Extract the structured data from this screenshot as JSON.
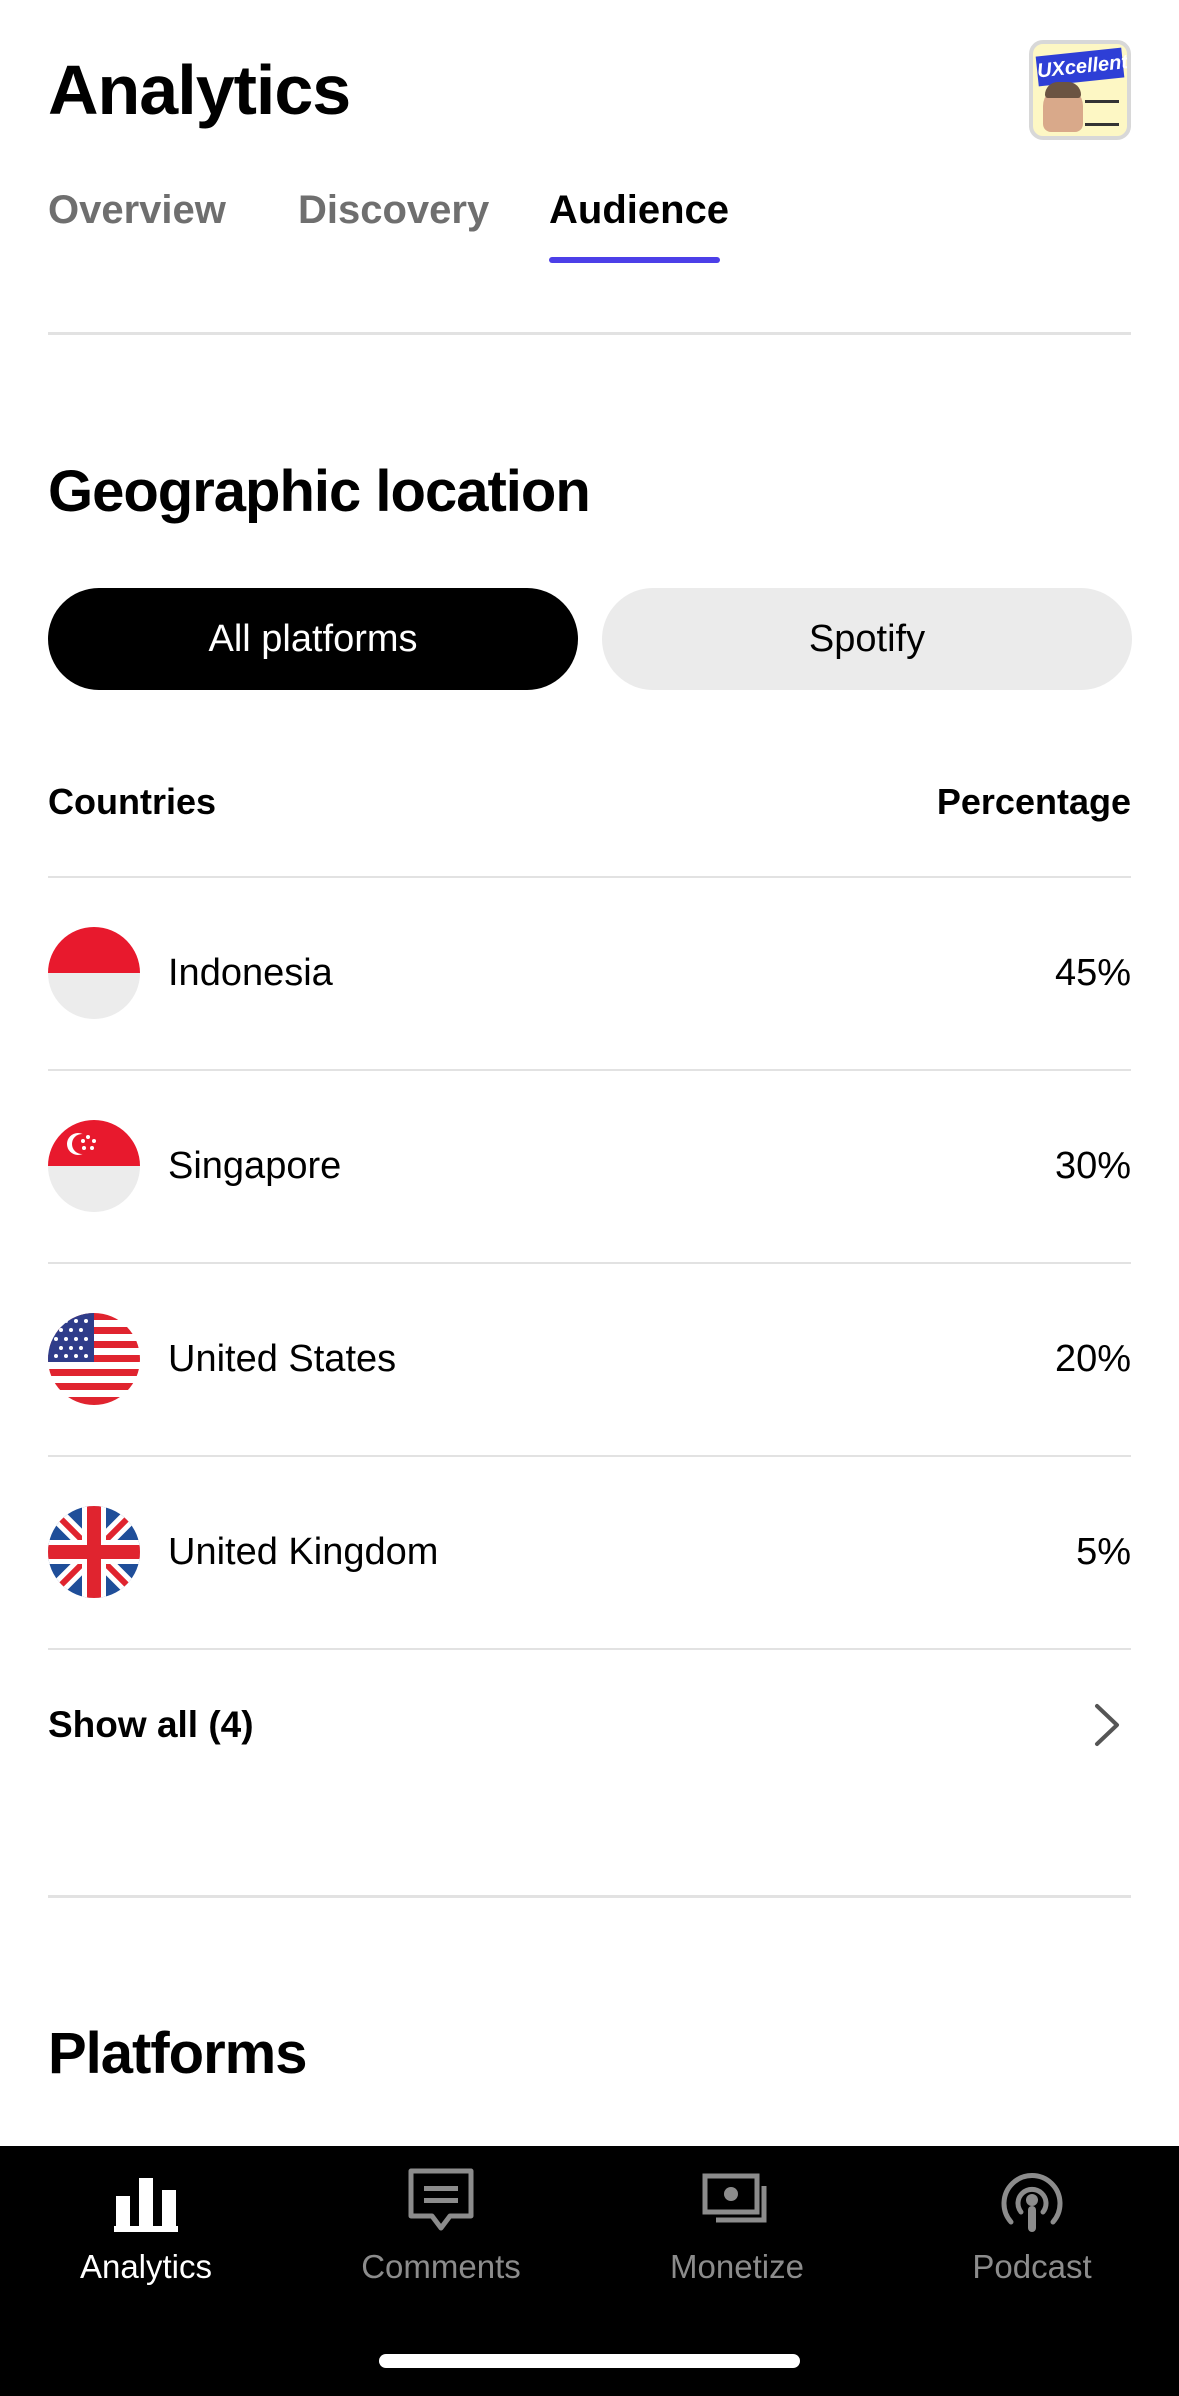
{
  "header": {
    "title": "Analytics",
    "avatar_logo_text": "UXcellent"
  },
  "tabs": [
    {
      "label": "Overview",
      "active": false
    },
    {
      "label": "Discovery",
      "active": false
    },
    {
      "label": "Audience",
      "active": true
    }
  ],
  "geo": {
    "title": "Geographic location",
    "filters": [
      {
        "label": "All platforms",
        "selected": true
      },
      {
        "label": "Spotify",
        "selected": false
      }
    ],
    "columns": {
      "countries": "Countries",
      "percentage": "Percentage"
    },
    "rows": [
      {
        "country": "Indonesia",
        "percentage": "45%",
        "flag_icon": "indonesia-flag-icon"
      },
      {
        "country": "Singapore",
        "percentage": "30%",
        "flag_icon": "singapore-flag-icon"
      },
      {
        "country": "United States",
        "percentage": "20%",
        "flag_icon": "us-flag-icon"
      },
      {
        "country": "United Kingdom",
        "percentage": "5%",
        "flag_icon": "uk-flag-icon"
      }
    ],
    "show_all": "Show all (4)"
  },
  "platforms": {
    "title": "Platforms"
  },
  "bottom_nav": [
    {
      "label": "Analytics",
      "icon": "bar-chart-icon",
      "active": true
    },
    {
      "label": "Comments",
      "icon": "comment-icon",
      "active": false
    },
    {
      "label": "Monetize",
      "icon": "money-icon",
      "active": false
    },
    {
      "label": "Podcast",
      "icon": "podcast-icon",
      "active": false
    }
  ],
  "colors": {
    "accent": "#4c3fe8",
    "pill_selected_bg": "#000000",
    "pill_unselected_bg": "#ebebeb",
    "nav_bg": "#000000",
    "nav_inactive": "#8c8c8c",
    "divider": "#e2e2e2"
  }
}
